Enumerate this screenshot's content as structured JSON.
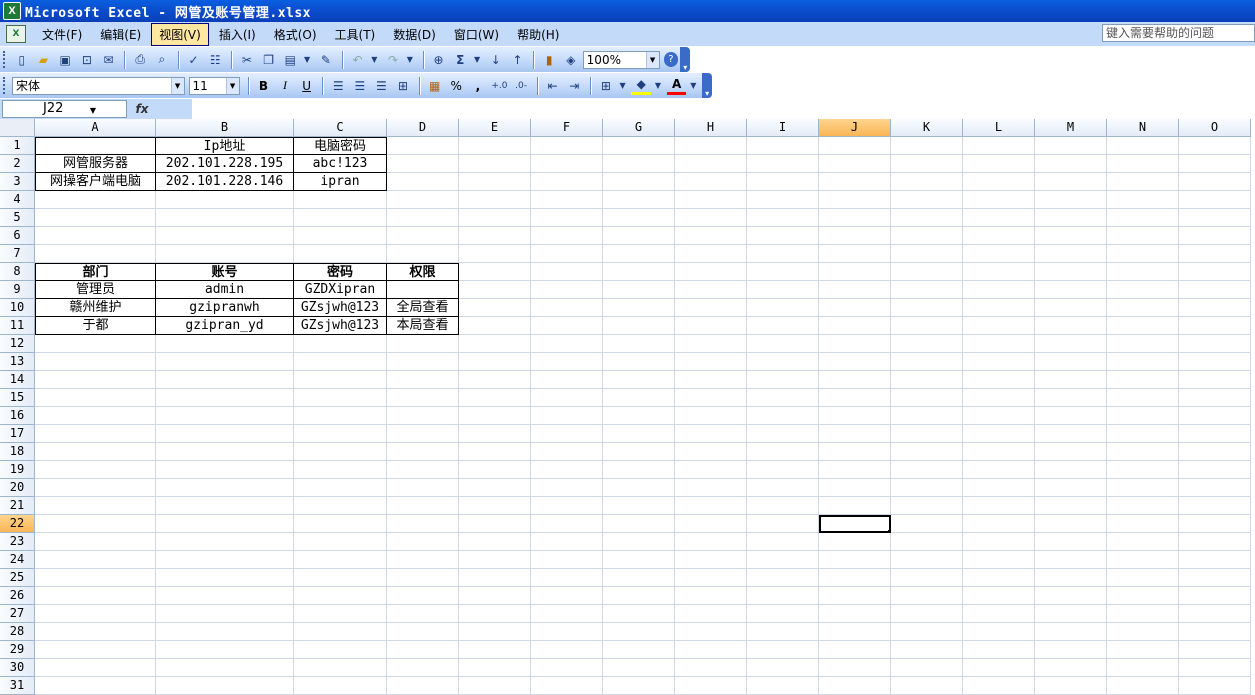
{
  "window": {
    "title": "Microsoft Excel - 网管及账号管理.xlsx"
  },
  "menu": {
    "items": [
      "文件(F)",
      "编辑(E)",
      "视图(V)",
      "插入(I)",
      "格式(O)",
      "工具(T)",
      "数据(D)",
      "窗口(W)",
      "帮助(H)"
    ],
    "active_index": 2,
    "help_placeholder": "键入需要帮助的问题"
  },
  "toolbar_standard": {
    "zoom": "100%"
  },
  "toolbar_format": {
    "font": "宋体",
    "size": "11",
    "bold": "B",
    "italic": "I",
    "underline": "U",
    "percent": "%",
    "comma": ","
  },
  "formula_bar": {
    "cell_ref": "J22",
    "fx": "fx",
    "content": ""
  },
  "grid": {
    "columns": [
      "A",
      "B",
      "C",
      "D",
      "E",
      "F",
      "G",
      "H",
      "I",
      "J",
      "K",
      "L",
      "M",
      "N",
      "O"
    ],
    "selected_column": "J",
    "row_count": 31,
    "selected_row": 22,
    "rows": {
      "1": [
        "",
        "Ip地址",
        "电脑密码",
        ""
      ],
      "2": [
        "网管服务器",
        "202.101.228.195",
        "abc!123",
        ""
      ],
      "3": [
        "网操客户端电脑",
        "202.101.228.146",
        "ipran",
        ""
      ],
      "8": [
        "部门",
        "账号",
        "密码",
        "权限"
      ],
      "9": [
        "管理员",
        "admin",
        "GZDXipran",
        ""
      ],
      "10": [
        "赣州维护",
        "gzipranwh",
        "GZsjwh@123",
        "全局查看"
      ],
      "11": [
        "于都",
        "gzipran_yd",
        "GZsjwh@123",
        "本局查看"
      ]
    }
  },
  "colors": {
    "title_bar": "#0b49c8",
    "menu_bg": "#c3daf9",
    "header_selected": "#f9b556",
    "gridline": "#d0d7e5"
  }
}
